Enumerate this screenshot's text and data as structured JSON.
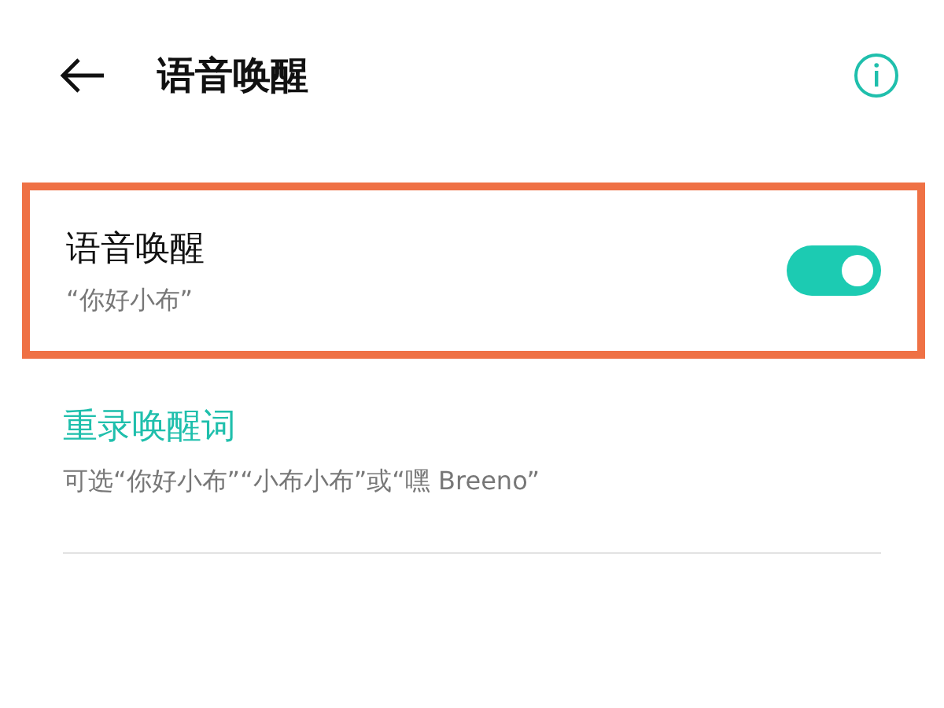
{
  "header": {
    "title": "语音唤醒"
  },
  "wake_setting": {
    "title": "语音唤醒",
    "subtitle": "“你好小布”",
    "on": true,
    "highlighted": true
  },
  "rerecord": {
    "title": "重录唤醒词",
    "description": "可选“你好小布”“小布小布”或“嘿 Breeno”"
  }
}
